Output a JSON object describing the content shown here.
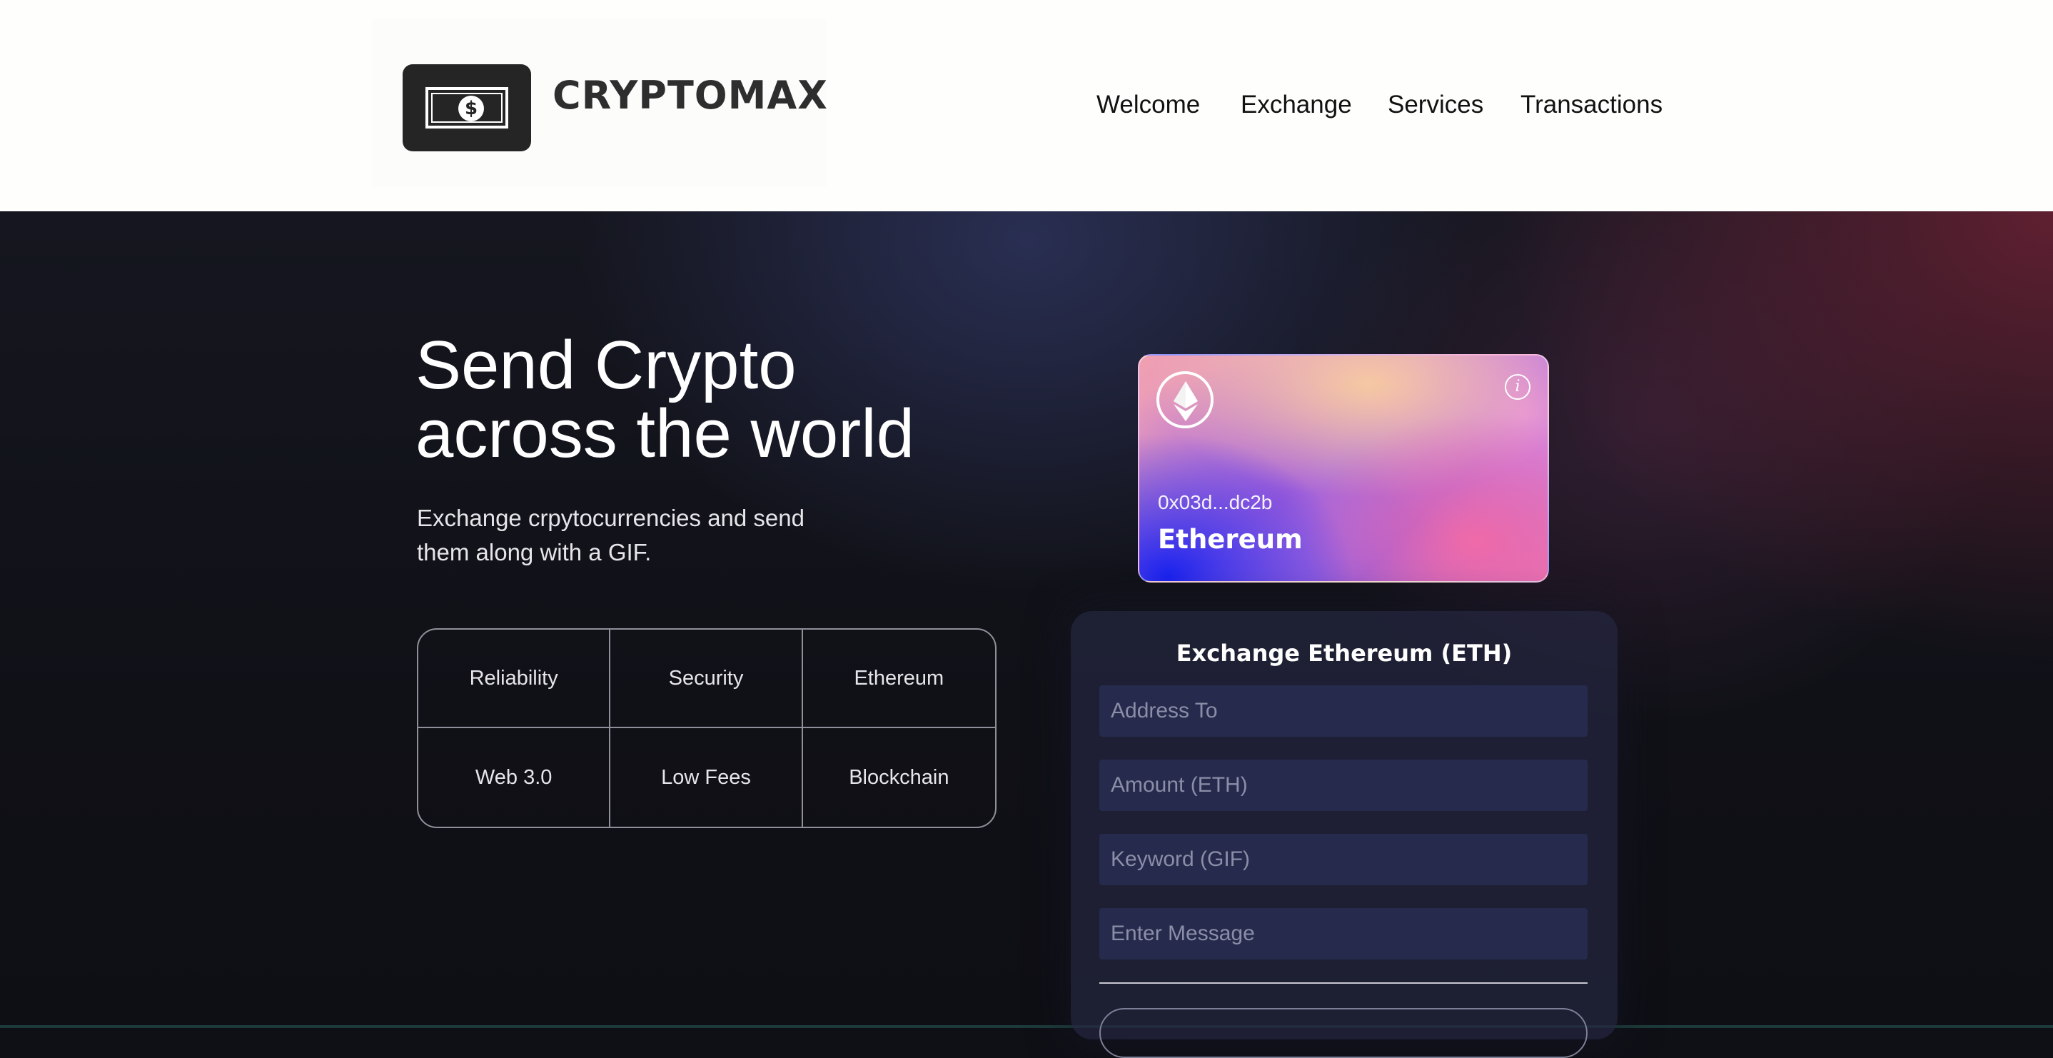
{
  "header": {
    "brand": "CRYPTOMAX",
    "logo_icon": "dollar-bill-icon",
    "nav": [
      "Welcome",
      "Exchange",
      "Services",
      "Transactions"
    ]
  },
  "hero": {
    "headline_line1": "Send Crypto",
    "headline_line2": "across the world",
    "subtext": "Exchange crpytocurrencies and send them along with a GIF.",
    "features": [
      "Reliability",
      "Security",
      "Ethereum",
      "Web 3.0",
      "Low Fees",
      "Blockchain"
    ]
  },
  "card": {
    "icon": "ethereum-icon",
    "info_icon": "info-icon",
    "address": "0x03d...dc2b",
    "name": "Ethereum"
  },
  "exchange": {
    "title": "Exchange Ethereum (ETH)",
    "address_placeholder": "Address To",
    "amount_placeholder": "Amount (ETH)",
    "keyword_placeholder": "Keyword (GIF)",
    "message_placeholder": "Enter Message"
  },
  "colors": {
    "header_bg": "#fefefc",
    "hero_bg": "#101117",
    "field_bg": "#262b4e",
    "card_blue": "#1a22f0",
    "card_pink": "#f06aa8"
  }
}
